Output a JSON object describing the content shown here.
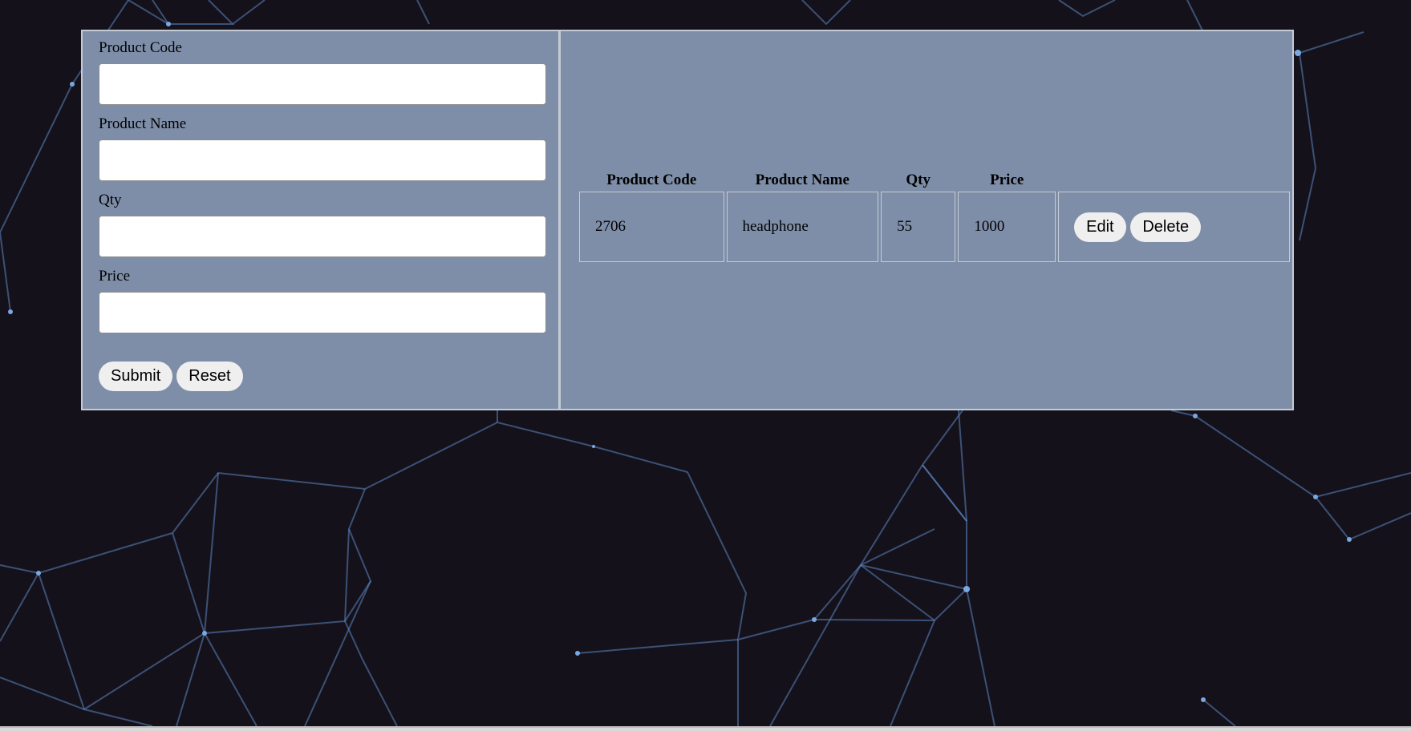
{
  "form": {
    "fields": [
      {
        "label": "Product Code",
        "value": "",
        "placeholder": ""
      },
      {
        "label": "Product Name",
        "value": "",
        "placeholder": ""
      },
      {
        "label": "Qty",
        "value": "",
        "placeholder": ""
      },
      {
        "label": "Price",
        "value": "",
        "placeholder": ""
      }
    ],
    "submit_label": "Submit",
    "reset_label": "Reset"
  },
  "list": {
    "headers": [
      "Product Code",
      "Product Name",
      "Qty",
      "Price",
      ""
    ],
    "rows": [
      {
        "code": "2706",
        "name": "headphone",
        "qty": "55",
        "price": "1000",
        "edit_label": "Edit",
        "delete_label": "Delete"
      }
    ]
  },
  "colors": {
    "background": "#15111a",
    "panel": "#7f8ea8",
    "panel_border": "#c5cbd6",
    "network_lines": "#5b86c2",
    "button": "#efefef"
  }
}
